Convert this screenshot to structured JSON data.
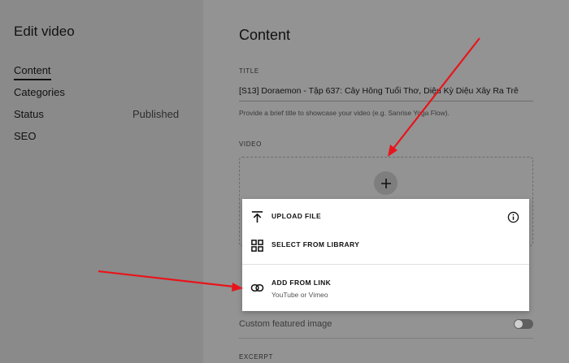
{
  "sidebar": {
    "title": "Edit video",
    "items": [
      {
        "label": "Content"
      },
      {
        "label": "Categories"
      },
      {
        "label": "Status",
        "value": "Published"
      },
      {
        "label": "SEO"
      }
    ]
  },
  "content": {
    "heading": "Content",
    "title_field": {
      "label": "TITLE",
      "value": "[S13] Doraemon - Tập 637: Cây Hông Tuổi Thơ, Diệu Kỳ Diệu Xây Ra Trê",
      "helper": "Provide a brief title to showcase your video (e.g. Sanrise Yoga Flow)."
    },
    "video_field": {
      "label": "VIDEO"
    },
    "featured_image": {
      "label": "Custom featured image"
    },
    "excerpt_label": "EXCERPT"
  },
  "menu": {
    "upload": "UPLOAD FILE",
    "library": "SELECT FROM LIBRARY",
    "link": "ADD FROM LINK",
    "link_sub": "YouTube or Vimeo"
  },
  "icons": {
    "plus": "plus-icon",
    "upload": "upload-icon",
    "grid": "grid-icon",
    "link": "link-icon",
    "info": "info-icon"
  },
  "colors": {
    "arrow": "#e8141b",
    "overlay": "#8d8d8d",
    "menu_bg": "#ffffff"
  }
}
